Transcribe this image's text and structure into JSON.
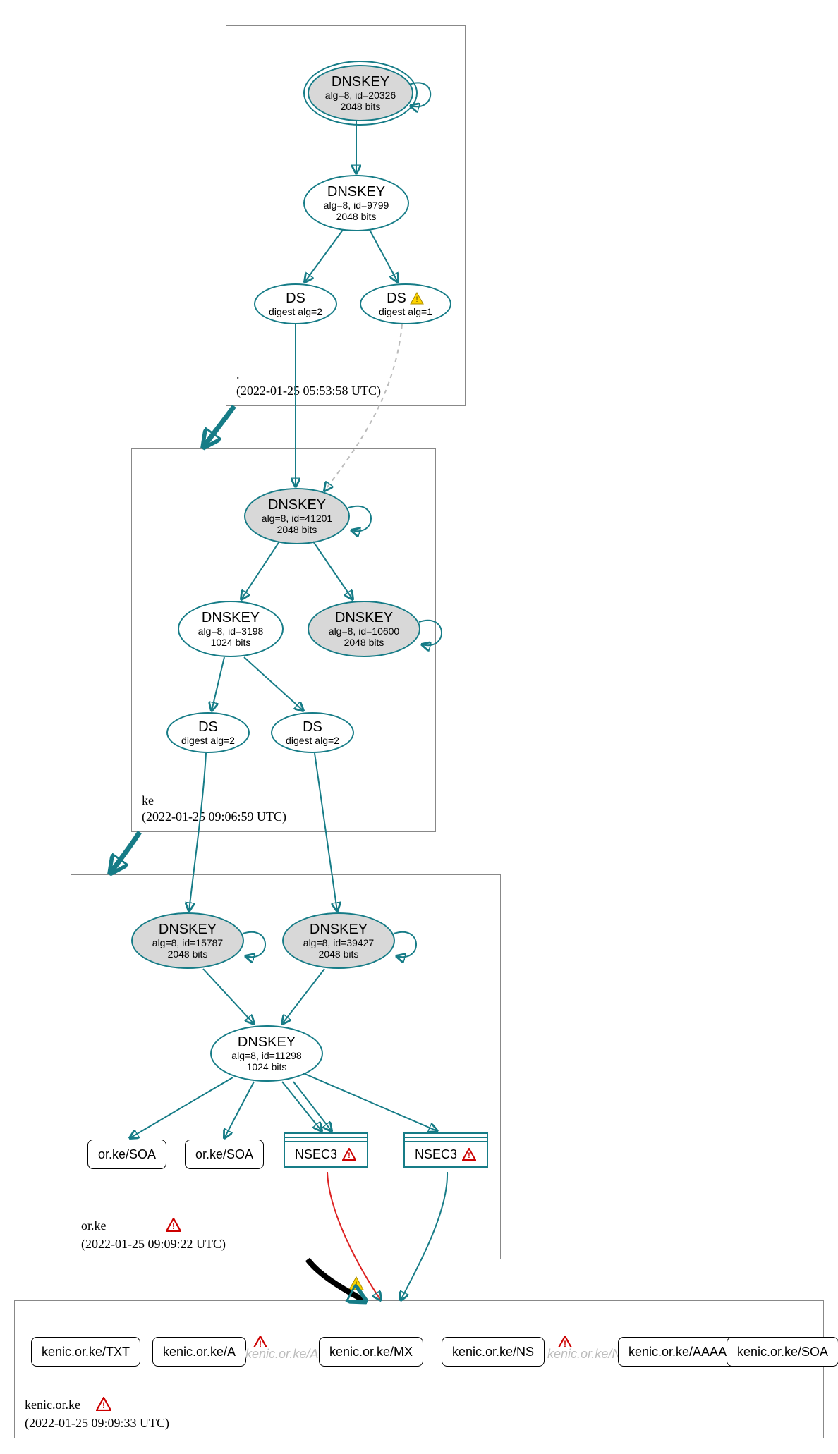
{
  "colors": {
    "teal": "#167c87",
    "red": "#d22",
    "gray_fill": "#d8d8d8"
  },
  "icons": {
    "warning": "warning-triangle",
    "error": "error-triangle"
  },
  "zones": {
    "root": {
      "name": ".",
      "timestamp": "(2022-01-25 05:53:58 UTC)",
      "nodes": {
        "dnskey_20326": {
          "title": "DNSKEY",
          "line1": "alg=8, id=20326",
          "line2": "2048 bits"
        },
        "dnskey_9799": {
          "title": "DNSKEY",
          "line1": "alg=8, id=9799",
          "line2": "2048 bits"
        },
        "ds_alg2": {
          "title": "DS",
          "line1": "digest alg=2"
        },
        "ds_alg1": {
          "title": "DS",
          "line1": "digest alg=1"
        }
      }
    },
    "ke": {
      "name": "ke",
      "timestamp": "(2022-01-25 09:06:59 UTC)",
      "nodes": {
        "dnskey_41201": {
          "title": "DNSKEY",
          "line1": "alg=8, id=41201",
          "line2": "2048 bits"
        },
        "dnskey_3198": {
          "title": "DNSKEY",
          "line1": "alg=8, id=3198",
          "line2": "1024 bits"
        },
        "dnskey_10600": {
          "title": "DNSKEY",
          "line1": "alg=8, id=10600",
          "line2": "2048 bits"
        },
        "ds_a": {
          "title": "DS",
          "line1": "digest alg=2"
        },
        "ds_b": {
          "title": "DS",
          "line1": "digest alg=2"
        }
      }
    },
    "orke": {
      "name": "or.ke",
      "timestamp": "(2022-01-25 09:09:22 UTC)",
      "has_error": true,
      "nodes": {
        "dnskey_15787": {
          "title": "DNSKEY",
          "line1": "alg=8, id=15787",
          "line2": "2048 bits"
        },
        "dnskey_39427": {
          "title": "DNSKEY",
          "line1": "alg=8, id=39427",
          "line2": "2048 bits"
        },
        "dnskey_11298": {
          "title": "DNSKEY",
          "line1": "alg=8, id=11298",
          "line2": "1024 bits"
        },
        "soa1": {
          "label": "or.ke/SOA"
        },
        "soa2": {
          "label": "or.ke/SOA"
        },
        "nsec3a": {
          "label": "NSEC3"
        },
        "nsec3b": {
          "label": "NSEC3"
        }
      }
    },
    "kenic": {
      "name": "kenic.or.ke",
      "timestamp": "(2022-01-25 09:09:33 UTC)",
      "has_error": true,
      "records": {
        "txt": {
          "label": "kenic.or.ke/TXT"
        },
        "a": {
          "label": "kenic.or.ke/A"
        },
        "a_err": {
          "label": "kenic.or.ke/A"
        },
        "mx": {
          "label": "kenic.or.ke/MX"
        },
        "ns": {
          "label": "kenic.or.ke/NS"
        },
        "ns_err": {
          "label": "kenic.or.ke/NS"
        },
        "aaaa": {
          "label": "kenic.or.ke/AAAA"
        },
        "soa": {
          "label": "kenic.or.ke/SOA"
        }
      }
    }
  }
}
